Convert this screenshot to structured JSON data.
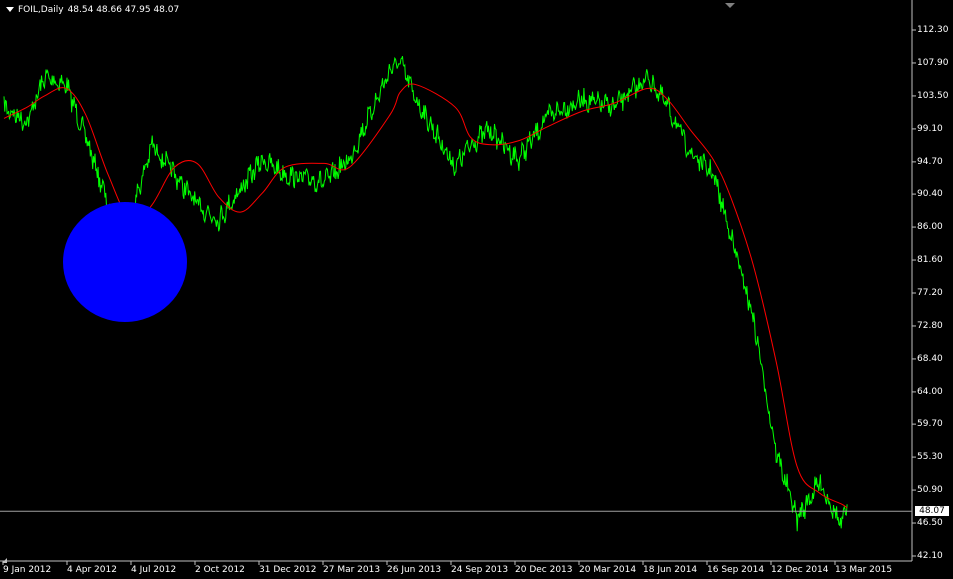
{
  "header": {
    "symbol": "FOIL,Daily",
    "ohlc": "48.54 48.66 47.95 48.07"
  },
  "chart_data": {
    "type": "line",
    "ylim": [
      42.1,
      112.3
    ],
    "y_ticks": [
      "112.30",
      "107.90",
      "103.50",
      "99.10",
      "94.70",
      "90.40",
      "86.00",
      "81.60",
      "77.20",
      "72.80",
      "68.40",
      "64.00",
      "59.70",
      "55.30",
      "50.90",
      "46.50",
      "42.10"
    ],
    "x_ticks": [
      "9 Jan 2012",
      "4 Apr 2012",
      "4 Jul 2012",
      "2 Oct 2012",
      "31 Dec 2012",
      "27 Mar 2013",
      "26 Jun 2013",
      "24 Sep 2013",
      "20 Dec 2013",
      "20 Mar 2014",
      "18 Jun 2014",
      "16 Sep 2014",
      "12 Dec 2014",
      "13 Mar 2015"
    ],
    "current_price": "48.07",
    "series": [
      {
        "style": "price",
        "color": "#00ff00",
        "x": [
          "2012-01-09",
          "2012-02-10",
          "2012-03-05",
          "2012-04-04",
          "2012-05-01",
          "2012-06-01",
          "2012-06-15",
          "2012-07-04",
          "2012-08-01",
          "2012-09-01",
          "2012-10-02",
          "2012-11-01",
          "2012-12-01",
          "2012-12-31",
          "2013-02-01",
          "2013-03-27",
          "2013-05-01",
          "2013-06-26",
          "2013-07-10",
          "2013-08-01",
          "2013-09-24",
          "2013-10-15",
          "2013-11-10",
          "2013-12-20",
          "2014-02-01",
          "2014-03-20",
          "2014-05-01",
          "2014-06-18",
          "2014-07-15",
          "2014-08-15",
          "2014-09-16",
          "2014-10-10",
          "2014-11-10",
          "2014-12-12",
          "2015-01-10",
          "2015-02-10",
          "2015-03-13",
          "2015-03-20"
        ],
        "y": [
          102.0,
          100.0,
          106.0,
          105.0,
          98.0,
          89.0,
          79.0,
          88.0,
          97.0,
          93.0,
          89.0,
          87.0,
          91.0,
          95.0,
          93.0,
          92.0,
          95.0,
          107.0,
          108.0,
          103.0,
          94.0,
          97.0,
          99.0,
          95.0,
          101.0,
          103.0,
          102.0,
          106.0,
          102.0,
          96.0,
          93.0,
          85.0,
          74.0,
          56.0,
          47.0,
          52.0,
          46.0,
          49.0
        ]
      },
      {
        "style": "moving-average",
        "color": "#ff0000",
        "x": [
          "2012-01-09",
          "2012-02-10",
          "2012-03-05",
          "2012-04-04",
          "2012-05-01",
          "2012-06-01",
          "2012-07-04",
          "2012-08-01",
          "2012-09-01",
          "2012-10-02",
          "2012-11-01",
          "2012-12-01",
          "2012-12-31",
          "2013-02-01",
          "2013-03-27",
          "2013-05-01",
          "2013-06-26",
          "2013-07-10",
          "2013-08-01",
          "2013-09-24",
          "2013-10-15",
          "2013-11-10",
          "2013-12-20",
          "2014-02-01",
          "2014-03-20",
          "2014-05-01",
          "2014-06-18",
          "2014-07-15",
          "2014-08-15",
          "2014-09-16",
          "2014-10-10",
          "2014-11-10",
          "2014-12-12",
          "2015-01-10",
          "2015-02-10",
          "2015-03-13",
          "2015-03-20"
        ],
        "y": [
          100.5,
          102.0,
          103.5,
          104.5,
          101.0,
          93.0,
          86.5,
          89.0,
          94.0,
          94.5,
          90.0,
          88.0,
          90.5,
          94.0,
          94.5,
          94.0,
          101.0,
          104.0,
          105.0,
          102.0,
          98.0,
          97.0,
          97.5,
          99.5,
          101.5,
          102.5,
          104.5,
          103.0,
          99.0,
          95.0,
          90.0,
          81.0,
          68.0,
          54.0,
          50.5,
          49.0,
          48.5
        ]
      }
    ]
  },
  "colors": {
    "background": "#000000",
    "axis": "#c0c0c0",
    "price_line": "#00ff00",
    "ma_line": "#ff0000",
    "marker": "#0000ff"
  }
}
